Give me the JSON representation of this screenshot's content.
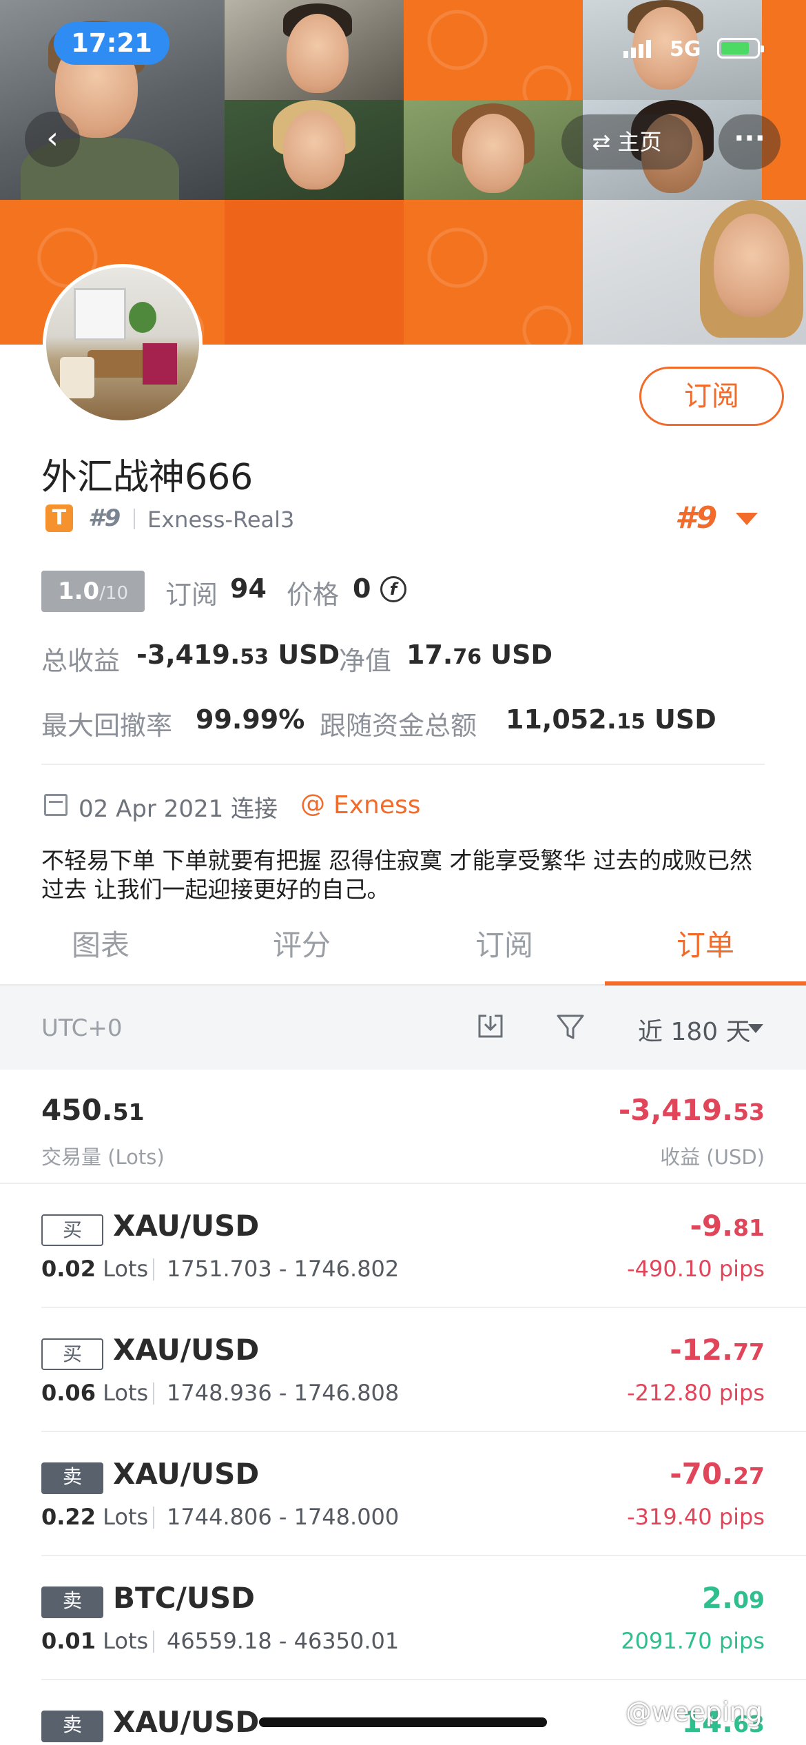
{
  "status_bar": {
    "time": "17:21",
    "network": "5G"
  },
  "nav": {
    "back_icon": "chevron-left-icon",
    "home_label": "⇄ 主页",
    "more_label": "···"
  },
  "profile": {
    "name": "外汇战神666",
    "badge": "T",
    "rank_small": "#9",
    "broker_account": "Exness-Real3",
    "rank_big": "#9",
    "subscribe_label": "订阅"
  },
  "stats": {
    "score_main": "1.0",
    "score_sub": "/10",
    "subscriptions_label": "订阅",
    "subscriptions_value": "94",
    "price_label": "价格",
    "price_value": "0",
    "coin_symbol": "f",
    "total_profit_label": "总收益",
    "total_profit_main": "-3,419.",
    "total_profit_dec": "53",
    "total_profit_unit": " USD",
    "equity_label": "净值",
    "equity_main": "17.",
    "equity_dec": "76",
    "equity_unit": " USD",
    "max_drawdown_label": "最大回撤率",
    "max_drawdown_value": "99.99%",
    "follow_funds_label": "跟随资金总额",
    "follow_funds_main": "11,052.",
    "follow_funds_dec": "15",
    "follow_funds_unit": " USD"
  },
  "connection": {
    "date": "02 Apr 2021 连接",
    "at": "@",
    "broker": "Exness"
  },
  "bio": "不轻易下单 下单就要有把握 忍得住寂寞 才能享受繁华 过去的成败已然过去 让我们一起迎接更好的自己。",
  "tabs": [
    {
      "label": "图表"
    },
    {
      "label": "评分"
    },
    {
      "label": "订阅"
    },
    {
      "label": "订单",
      "active": true
    }
  ],
  "filter": {
    "timezone": "UTC+0",
    "period": "近 180 天"
  },
  "summary": {
    "lots_main": "450.",
    "lots_dec": "51",
    "lots_label": "交易量 (Lots)",
    "profit_main": "-3,419.",
    "profit_dec": "53",
    "profit_label": "收益 (USD)"
  },
  "orders": [
    {
      "side": "买",
      "type": "buy",
      "symbol": "XAU/USD",
      "lots": "0.02",
      "lots_unit": " Lots",
      "range": "1751.703 - 1746.802",
      "pnl_main": "-9.",
      "pnl_dec": "81",
      "pips": "-490.10 pips",
      "sign": "neg"
    },
    {
      "side": "买",
      "type": "buy",
      "symbol": "XAU/USD",
      "lots": "0.06",
      "lots_unit": " Lots",
      "range": "1748.936 - 1746.808",
      "pnl_main": "-12.",
      "pnl_dec": "77",
      "pips": "-212.80 pips",
      "sign": "neg"
    },
    {
      "side": "卖",
      "type": "sell",
      "symbol": "XAU/USD",
      "lots": "0.22",
      "lots_unit": " Lots",
      "range": "1744.806 - 1748.000",
      "pnl_main": "-70.",
      "pnl_dec": "27",
      "pips": "-319.40 pips",
      "sign": "neg"
    },
    {
      "side": "卖",
      "type": "sell",
      "symbol": "BTC/USD",
      "lots": "0.01",
      "lots_unit": " Lots",
      "range": "46559.18 - 46350.01",
      "pnl_main": "2.",
      "pnl_dec": "09",
      "pips": "2091.70 pips",
      "sign": "pos"
    },
    {
      "side": "卖",
      "type": "sell",
      "symbol": "XAU/USD",
      "lots": "",
      "lots_unit": "",
      "range": "",
      "pnl_main": "14.",
      "pnl_dec": "63",
      "pips": "",
      "sign": "pos"
    }
  ],
  "watermark": "@weeping",
  "colors": {
    "accent": "#f26b2a",
    "negative": "#e0455a",
    "positive": "#2fbf8f",
    "status_pill": "#2e8cf2"
  }
}
